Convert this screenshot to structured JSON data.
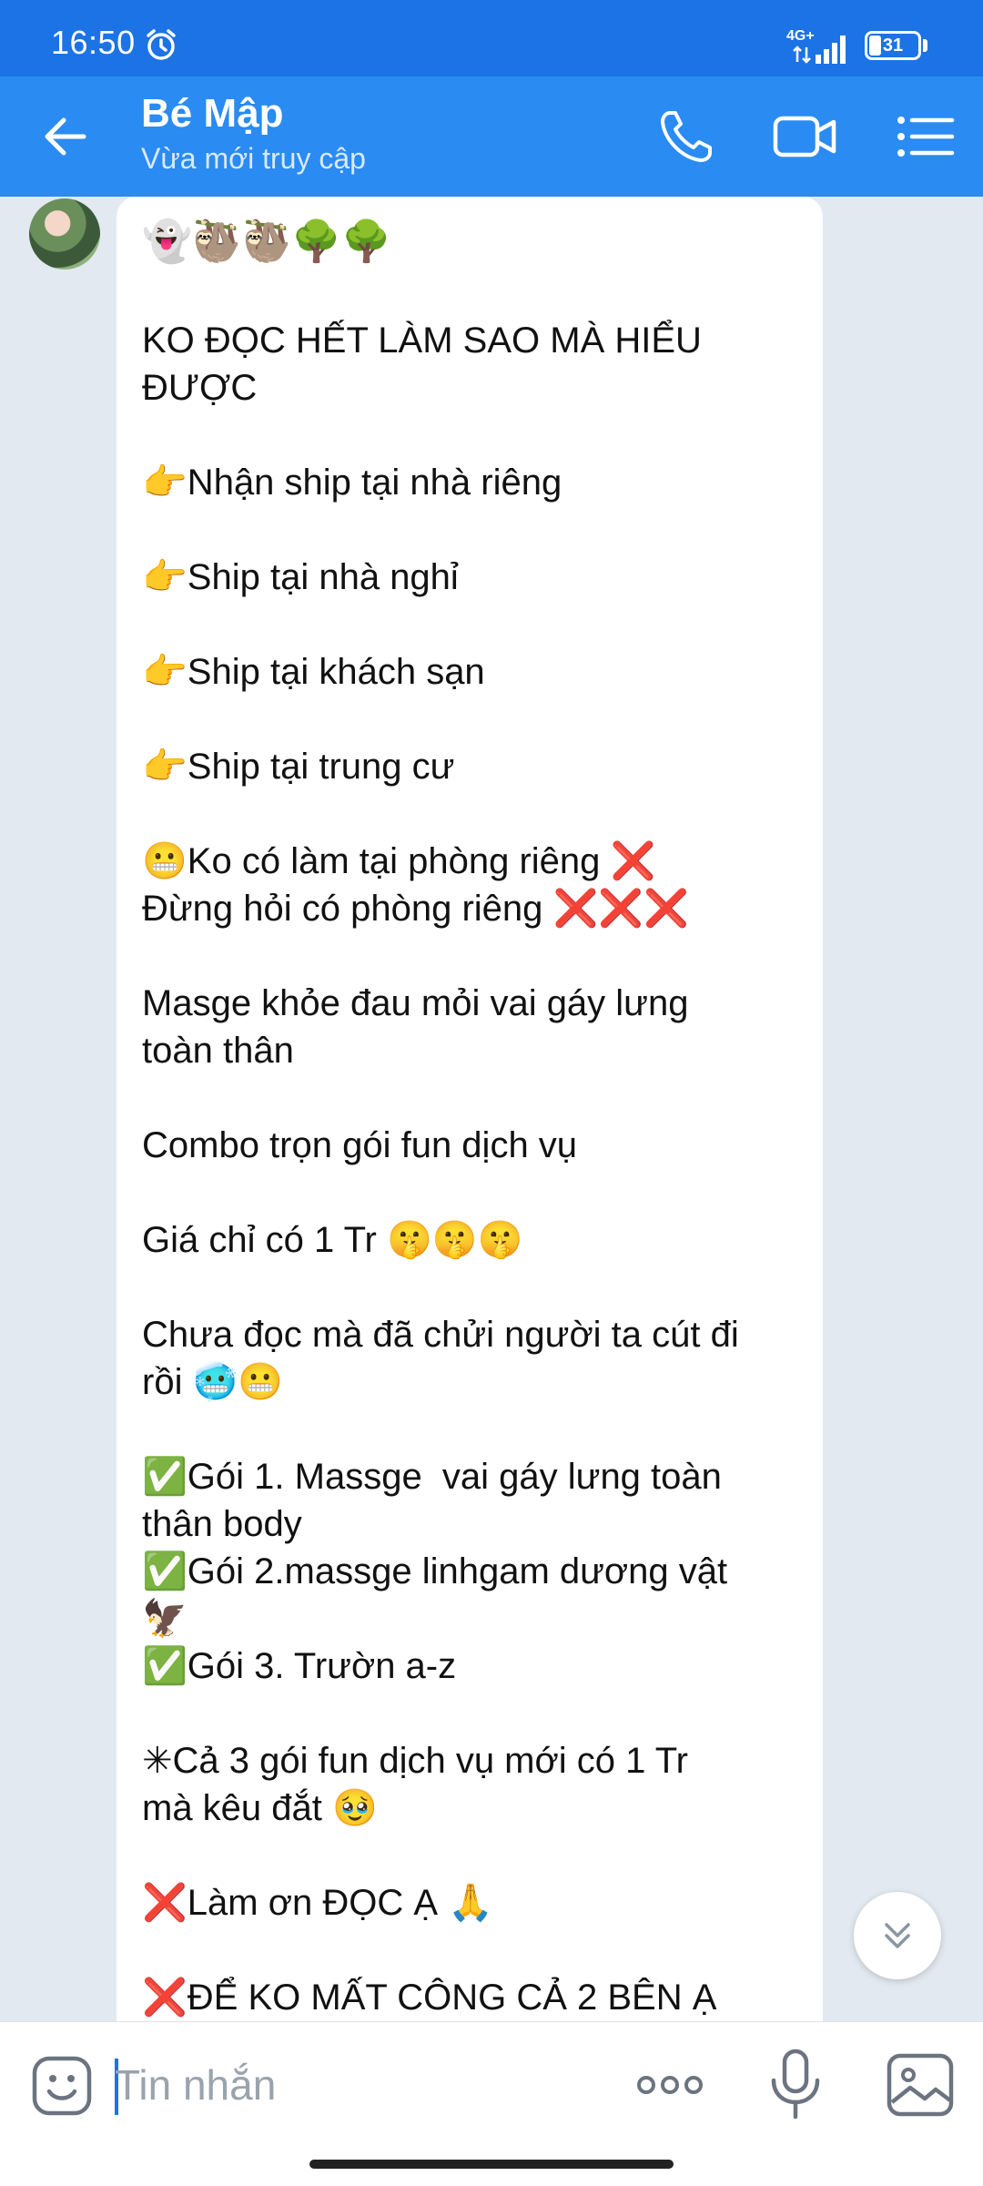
{
  "status_bar": {
    "time": "16:50",
    "network": "4G+",
    "battery": "31",
    "battery_level": 0.31
  },
  "header": {
    "contact_name": "Bé Mập",
    "contact_status": "Vừa mới truy cập",
    "icons": [
      "back-arrow-icon",
      "phone-icon",
      "video-call-icon",
      "menu-list-icon"
    ]
  },
  "message": {
    "lines": [
      "👻🦥🦥🌳🌳",
      "",
      "KO ĐỌC HẾT LÀM SAO MÀ HIỂU",
      "ĐƯỢC",
      "",
      "👉Nhận ship tại nhà riêng",
      "",
      "👉Ship tại nhà nghỉ",
      "",
      "👉Ship tại khách sạn",
      "",
      "👉Ship tại trung cư",
      "",
      "😬Ko có làm tại phòng riêng ❌",
      "Đừng hỏi có phòng riêng ❌❌❌",
      "",
      "Masge khỏe đau mỏi vai gáy lưng",
      "toàn thân",
      "",
      "Combo trọn gói fun dịch vụ",
      "",
      "Giá chỉ có 1 Tr 🤫🤫🤫",
      "",
      "Chưa đọc mà đã chửi người ta cút đi",
      "rồi 🥶😬",
      "",
      "✅Gói 1. Massge  vai gáy lưng toàn",
      "thân body",
      "✅Gói 2.massge linhgam dương vật",
      "🦅",
      "✅Gói 3. Trườn a-z",
      "",
      "✳Cả 3 gói fun dịch vụ mới có 1 Tr",
      "mà kêu đắt 🥹",
      "",
      "❌Làm ơn ĐỌC Ạ 🙏",
      "",
      "❌ĐỂ KO MẤT CÔNG CẢ 2 BÊN Ạ"
    ]
  },
  "input_bar": {
    "placeholder": "Tin nhắn",
    "icons": [
      "sticker-icon",
      "more-options-icon",
      "microphone-icon",
      "image-gallery-icon"
    ]
  },
  "colors": {
    "status_bar": "#1b73e6",
    "header": "#2a8bf2",
    "chat_background": "#e2e9f1",
    "bubble": "#ffffff",
    "cursor": "#1b73e6"
  }
}
